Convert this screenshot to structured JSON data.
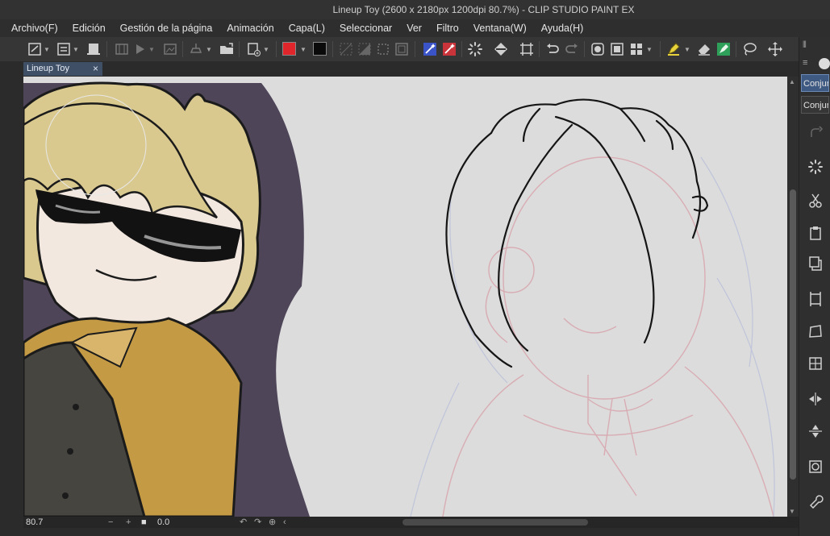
{
  "window": {
    "title": "Lineup Toy (2600 x 2180px 1200dpi 80.7%)  - CLIP STUDIO PAINT EX"
  },
  "menu": {
    "items": [
      "Archivo(F)",
      "Edición",
      "Gestión de la página",
      "Animación",
      "Capa(L)",
      "Seleccionar",
      "Ver",
      "Filtro",
      "Ventana(W)",
      "Ayuda(H)"
    ]
  },
  "toolbar": {
    "main_color": "#e0262b",
    "sub_color": "#0a0a0a",
    "icons": [
      "new-canvas-icon",
      "layer-settings-icon",
      "layer-panel-icon",
      "timeline-icon",
      "play-icon",
      "export-icon",
      "paste-icon",
      "open-folder-icon",
      "print-icon",
      "main-color-swatch",
      "sub-color-swatch",
      "selection-icon",
      "magic-wand-icon",
      "undo-icon",
      "redo-icon",
      "transform-icon",
      "pen-icon",
      "eraser-icon",
      "lasso-icon",
      "move-icon"
    ]
  },
  "document_tab": {
    "label": "Lineup Toy",
    "close": "×"
  },
  "status": {
    "zoom": "80.7",
    "rotation": "0.0",
    "minus": "−",
    "plus": "+"
  },
  "right_panel": {
    "buttons": [
      "Conjun",
      "Conjun"
    ]
  }
}
